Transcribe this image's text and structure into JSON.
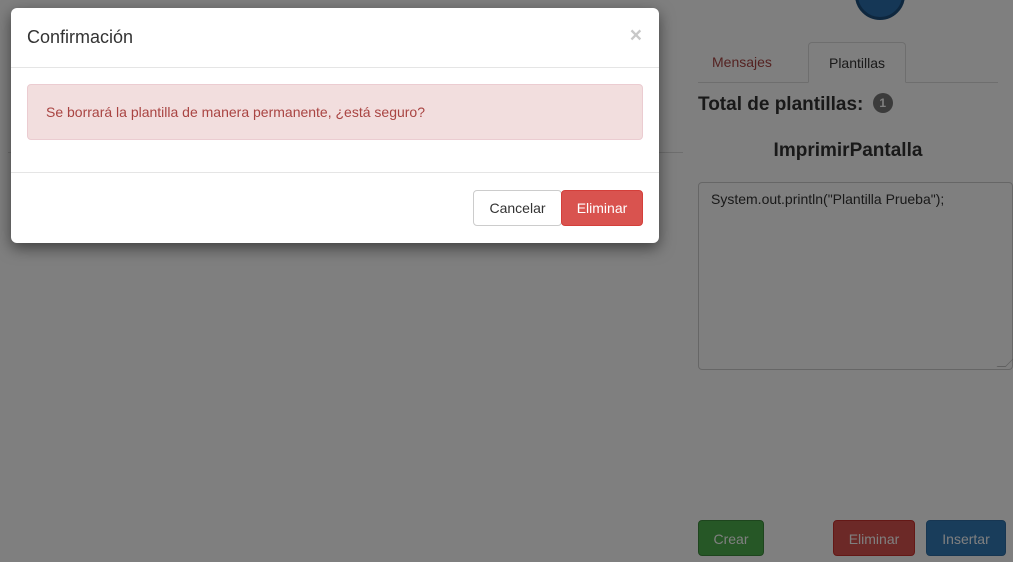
{
  "modal": {
    "title": "Confirmación",
    "close_symbol": "×",
    "message": "Se borrará la plantilla de manera permanente, ¿está seguro?",
    "cancel_label": "Cancelar",
    "delete_label": "Eliminar"
  },
  "panel": {
    "tabs": [
      {
        "label": "Mensajes",
        "active": false
      },
      {
        "label": "Plantillas",
        "active": true
      }
    ],
    "total_label": "Total de plantillas:",
    "total_count": "1",
    "template_name": "ImprimirPantalla",
    "template_content": "System.out.println(\"Plantilla Prueba\");",
    "create_label": "Crear",
    "delete_label": "Eliminar",
    "insert_label": "Insertar"
  },
  "colors": {
    "success": "#5cb85c",
    "danger": "#d9534f",
    "primary": "#337ab7",
    "alert_bg": "#f2dede",
    "alert_text": "#a94442"
  }
}
